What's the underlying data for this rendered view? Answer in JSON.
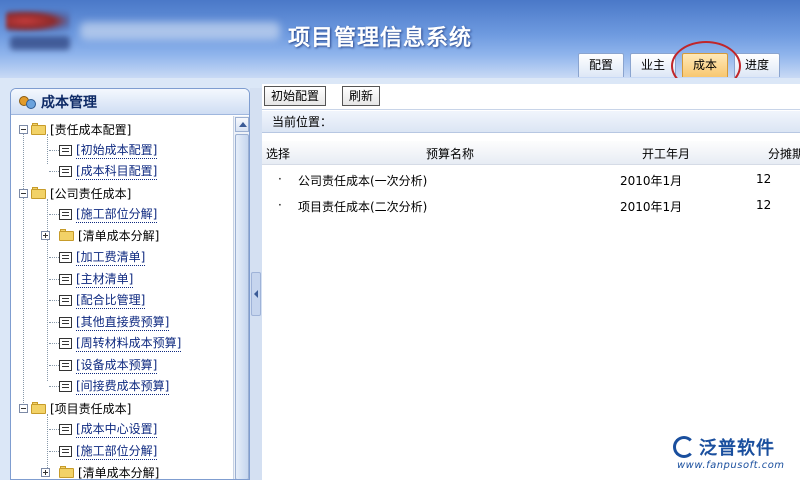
{
  "header": {
    "title": "项目管理信息系统",
    "tabs": [
      {
        "label": "配置",
        "active": false
      },
      {
        "label": "业主",
        "active": false
      },
      {
        "label": "成本",
        "active": true
      },
      {
        "label": "进度",
        "active": false
      }
    ],
    "highlight_color": "#c0262a"
  },
  "sidebar": {
    "title": "成本管理",
    "tree": [
      {
        "label": "[责任成本配置]",
        "type": "folder",
        "expanded": true
      },
      {
        "label": "[初始成本配置]",
        "type": "doc"
      },
      {
        "label": "[成本科目配置]",
        "type": "doc"
      },
      {
        "label": "[公司责任成本]",
        "type": "folder",
        "expanded": true
      },
      {
        "label": "[施工部位分解]",
        "type": "doc"
      },
      {
        "label": "[清单成本分解]",
        "type": "folder",
        "expanded": false
      },
      {
        "label": "[加工费清单]",
        "type": "doc"
      },
      {
        "label": "[主材清单]",
        "type": "doc"
      },
      {
        "label": "[配合比管理]",
        "type": "doc"
      },
      {
        "label": "[其他直接费预算]",
        "type": "doc"
      },
      {
        "label": "[周转材料成本预算]",
        "type": "doc"
      },
      {
        "label": "[设备成本预算]",
        "type": "doc"
      },
      {
        "label": "[间接费成本预算]",
        "type": "doc"
      },
      {
        "label": "[项目责任成本]",
        "type": "folder",
        "expanded": true
      },
      {
        "label": "[成本中心设置]",
        "type": "doc"
      },
      {
        "label": "[施工部位分解]",
        "type": "doc"
      },
      {
        "label": "[清单成本分解]",
        "type": "folder",
        "expanded": false
      }
    ]
  },
  "toolbar": {
    "init_label": "初始配置",
    "refresh_label": "刷新"
  },
  "breadcrumb": {
    "label": "当前位置："
  },
  "table": {
    "headers": [
      "选择",
      "预算名称",
      "开工年月",
      "分摊期"
    ],
    "rows": [
      {
        "bullet": "·",
        "name": "公司责任成本(一次分析)",
        "date": "2010年1月",
        "period": "12"
      },
      {
        "bullet": "·",
        "name": "项目责任成本(二次分析)",
        "date": "2010年1月",
        "period": "12"
      }
    ]
  },
  "watermark": {
    "name": "泛普软件",
    "url": "www.fanpusoft.com"
  }
}
